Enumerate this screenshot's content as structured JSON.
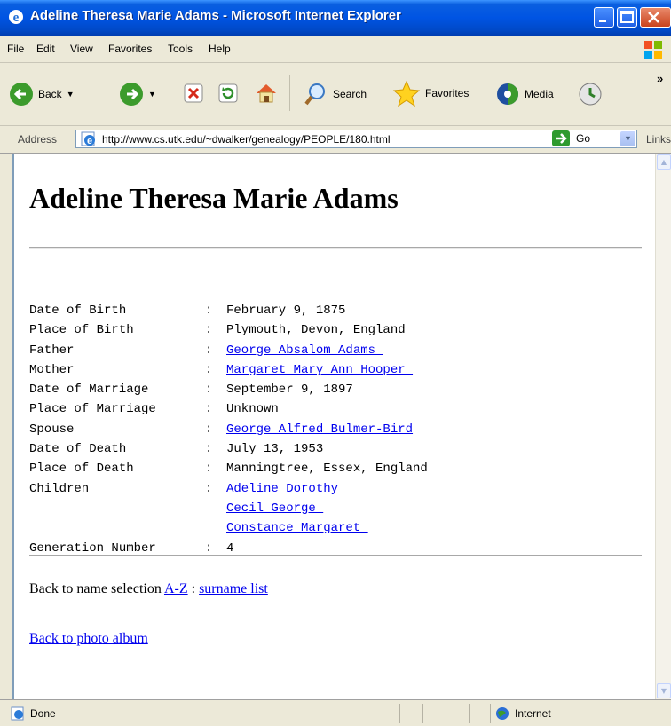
{
  "window": {
    "title": "Adeline Theresa Marie Adams - Microsoft Internet Explorer"
  },
  "menu": [
    "File",
    "Edit",
    "View",
    "Favorites",
    "Tools",
    "Help"
  ],
  "toolbar": {
    "back": "Back",
    "search": "Search",
    "favorites": "Favorites",
    "media": "Media"
  },
  "address": {
    "label": "Address",
    "url": "http://www.cs.utk.edu/~dwalker/genealogy/PEOPLE/180.html",
    "go": "Go",
    "links": "Links"
  },
  "page": {
    "heading": "Adeline Theresa Marie Adams",
    "facts": [
      {
        "label": "Date of Birth",
        "value": "February 9, 1875",
        "link": false
      },
      {
        "label": "Place of Birth",
        "value": "Plymouth, Devon, England",
        "link": false
      },
      {
        "label": "Father",
        "value": "George Absalom Adams ",
        "link": true
      },
      {
        "label": "Mother",
        "value": "Margaret Mary Ann Hooper ",
        "link": true
      },
      {
        "label": "Date of Marriage",
        "value": "September 9, 1897",
        "link": false
      },
      {
        "label": "Place of Marriage",
        "value": "Unknown",
        "link": false
      },
      {
        "label": "Spouse",
        "value": "George Alfred Bulmer-Bird",
        "link": true
      },
      {
        "label": "Date of Death",
        "value": "July 13, 1953",
        "link": false
      },
      {
        "label": "Place of Death",
        "value": "Manningtree, Essex, England",
        "link": false
      },
      {
        "label": "Children",
        "value": "Adeline Dorothy ",
        "link": true
      },
      {
        "label": "",
        "value": "Cecil George ",
        "link": true,
        "nosep": true
      },
      {
        "label": "",
        "value": "Constance Margaret ",
        "link": true,
        "nosep": true
      },
      {
        "label": "Generation Number",
        "value": "4",
        "link": false
      }
    ],
    "sep": ":",
    "back_text": "Back to name selection",
    "az_link": "A-Z",
    "colon": " : ",
    "surname_link": "surname list",
    "photo_link": "Back to photo album"
  },
  "status": {
    "text": "Done",
    "zone": "Internet"
  }
}
